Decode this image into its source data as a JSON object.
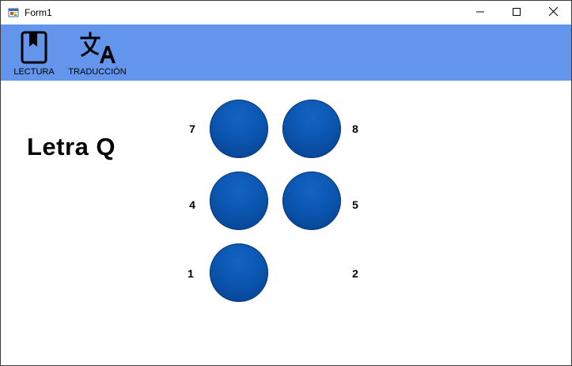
{
  "window": {
    "title": "Form1",
    "controls": {
      "minimize_icon": "minimize-icon",
      "maximize_icon": "maximize-icon",
      "close_icon": "close-icon"
    }
  },
  "toolbar": {
    "background": "#6495ed",
    "items": [
      {
        "label": "LECTURA",
        "icon": "bookmark-book-icon"
      },
      {
        "label": "TRADUCCIÓN",
        "icon": "translate-icon"
      }
    ]
  },
  "main": {
    "letter_title": "Letra Q",
    "braille_cells": [
      {
        "label": "7",
        "filled": true
      },
      {
        "label": "8",
        "filled": true
      },
      {
        "label": "4",
        "filled": true
      },
      {
        "label": "5",
        "filled": true
      },
      {
        "label": "1",
        "filled": true
      },
      {
        "label": "2",
        "filled": false
      }
    ],
    "dot_color": "#0b56b1"
  }
}
